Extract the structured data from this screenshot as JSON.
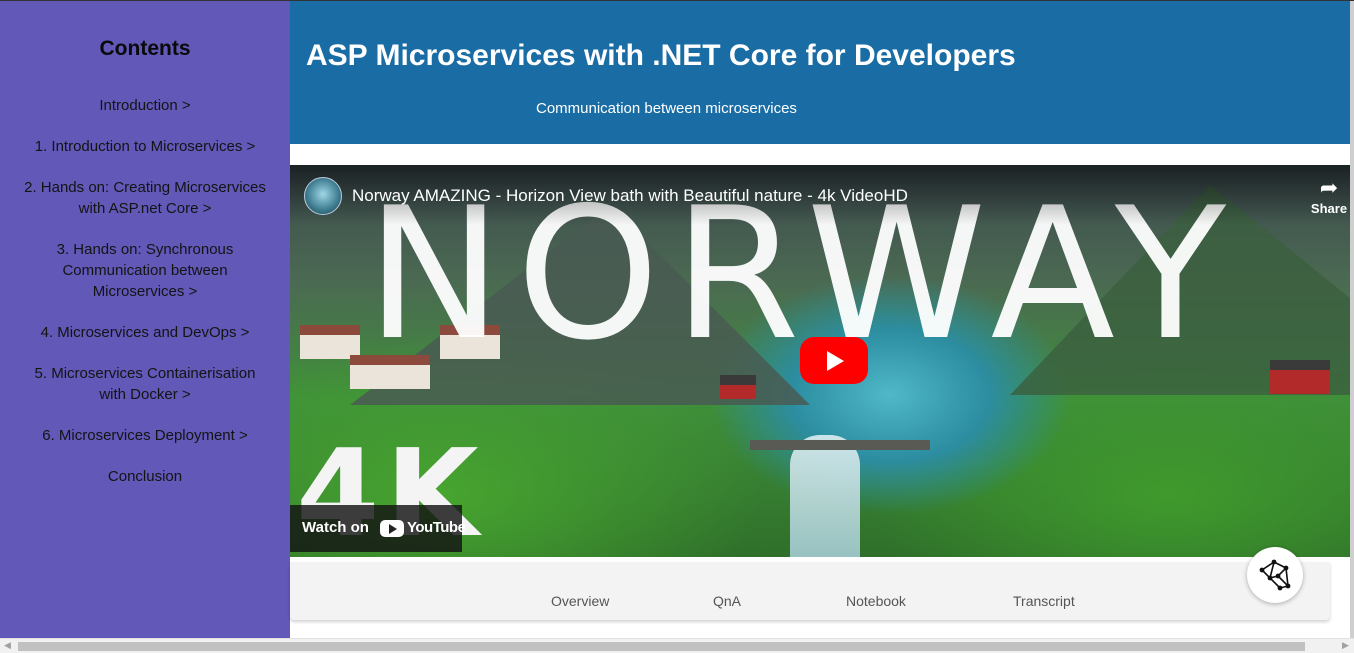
{
  "sidebar": {
    "title": "Contents",
    "items": [
      "Introduction >",
      "1. Introduction to Microservices >",
      "2. Hands on: Creating Microservices with ASP.net Core >",
      "3. Hands on: Synchronous Communication between Microservices >",
      "4. Microservices and DevOps >",
      "5. Microservices Containerisation with Docker >",
      "6. Microservices Deployment >",
      "Conclusion"
    ]
  },
  "header": {
    "title": "ASP Microservices with .NET Core for Developers",
    "subtitle": "Communication between microservices"
  },
  "video": {
    "title": "Norway AMAZING - Horizon View bath with Beautiful nature - 4k VideoHD",
    "share_label": "Share",
    "overlay_word": "NORWAY",
    "overlay_badge": "4K",
    "watch_on_label": "Watch on",
    "youtube_label": "YouTube"
  },
  "tabs": [
    "Overview",
    "QnA",
    "Notebook",
    "Transcript"
  ],
  "colors": {
    "sidebar_bg": "#6158b7",
    "header_bg": "#196ca4",
    "play_red": "#ff0000"
  }
}
